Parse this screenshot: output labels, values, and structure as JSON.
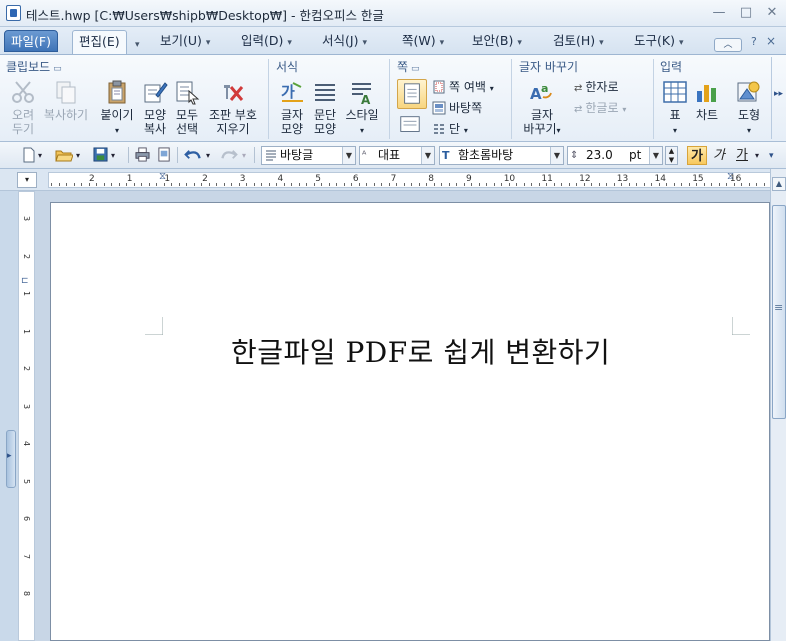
{
  "window": {
    "title": "테스트.hwp [C:₩Users₩shipb₩Desktop₩] - 한컴오피스 한글",
    "minimize": "—",
    "maximize": "□",
    "close": "✕"
  },
  "tabs": [
    {
      "label": "파일(F)"
    },
    {
      "label": "편집(E)"
    },
    {
      "label": "보기(U)"
    },
    {
      "label": "입력(D)"
    },
    {
      "label": "서식(J)"
    },
    {
      "label": "쪽(W)"
    },
    {
      "label": "보안(B)"
    },
    {
      "label": "검토(H)"
    },
    {
      "label": "도구(K)"
    }
  ],
  "tab_extras": {
    "help": "?",
    "close": "×"
  },
  "ribbon": {
    "clipboard": {
      "title": "클립보드",
      "cut": "오려\n두기",
      "copy": "복사하기",
      "paste": "붙이기",
      "format_copy_1": "모양",
      "format_copy_2": "복사",
      "select_all_1": "모두",
      "select_all_2": "선택",
      "erase_1": "조판 부호",
      "erase_2": "지우기"
    },
    "format": {
      "title": "서식",
      "char_1": "글자",
      "char_2": "모양",
      "para_1": "문단",
      "para_2": "모양",
      "style": "스타일"
    },
    "page": {
      "title": "쪽",
      "margin": "쪽 여백",
      "background": "바탕쪽",
      "columns": "단"
    },
    "convert": {
      "title": "글자 바꾸기",
      "hanja": "한자로",
      "hangul": "한글로",
      "char_change_1": "글자",
      "char_change_2": "바꾸기"
    },
    "input": {
      "title": "입력",
      "table": "표",
      "chart": "차트",
      "shape": "도형"
    }
  },
  "toolbar": {
    "style_combo": "바탕글",
    "lang_combo": "대표",
    "font_combo": "함초롬바탕",
    "size_value": "23.0",
    "size_unit": "pt",
    "bold": "가",
    "italic": "가",
    "underline": "가"
  },
  "ruler": {
    "numbers": [
      "2",
      "1",
      "1",
      "2",
      "3",
      "4",
      "5",
      "6",
      "7",
      "8",
      "9",
      "10",
      "11",
      "12",
      "13",
      "14",
      "15",
      "16"
    ]
  },
  "vruler": {
    "numbers": [
      "3",
      "2",
      "1",
      "1",
      "2",
      "3",
      "4",
      "5",
      "6",
      "7",
      "8"
    ]
  },
  "document": {
    "text": "한글파일 PDF로 쉽게 변환하기"
  }
}
